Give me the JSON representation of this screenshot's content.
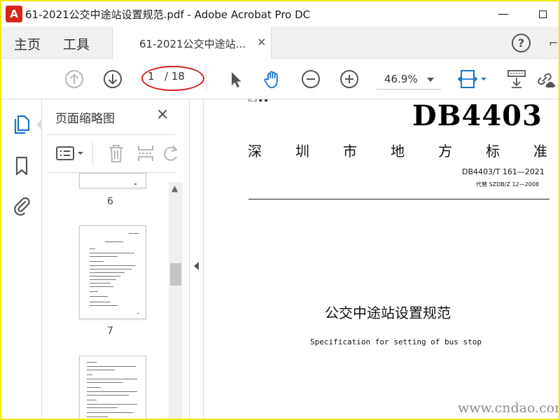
{
  "window": {
    "title": "61-2021公交中途站设置规范.pdf - Adobe Acrobat Pro DC",
    "app_logo_glyph": "A",
    "minimize_glyph": "—"
  },
  "tabs": {
    "home": "主页",
    "tools": "工具",
    "document": "61-2021公交中途站...",
    "close_glyph": "×",
    "help_glyph": "?"
  },
  "toolbar": {
    "current_page": "1",
    "total_pages": "/ 18",
    "zoom": "46.9%"
  },
  "thumbnails": {
    "title": "页面缩略图",
    "close_glyph": "×",
    "pages": [
      {
        "number": "6"
      },
      {
        "number": "7"
      }
    ]
  },
  "document": {
    "code": "DB4403",
    "city_chars": [
      "深",
      "圳",
      "市",
      "地",
      "方",
      "标",
      "准"
    ],
    "standard_no": "DB4403/T 161—2021",
    "replaces": "代替 SZDB/Z 12—2008",
    "title": "公交中途站设置规范",
    "subtitle": "Specification for setting of bus stop"
  },
  "watermark": "www.cndao.com",
  "colors": {
    "frame": "#f0e800",
    "icon_blue": "#1a73c8",
    "icon_gray": "#555555",
    "annotation_red": "#d81e1e"
  },
  "icons": {
    "prev_page": "arrow-up-circle-icon",
    "next_page": "arrow-down-circle-icon",
    "select": "cursor-arrow-icon",
    "hand": "hand-tool-icon",
    "zoom_out": "zoom-out-icon",
    "zoom_in": "zoom-in-icon",
    "fit": "fit-page-icon",
    "scroll_mode": "scroll-mode-icon",
    "share_link": "share-link-icon",
    "thumbnails": "thumbnails-panel-icon",
    "bookmarks": "bookmark-icon",
    "attachments": "paperclip-icon",
    "options": "panel-options-icon",
    "delete": "trash-icon",
    "insert": "insert-page-icon",
    "rotate": "rotate-icon"
  }
}
